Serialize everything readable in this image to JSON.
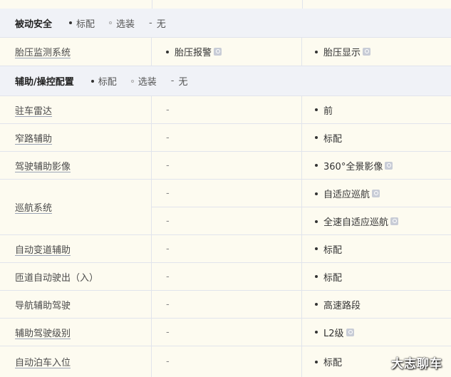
{
  "legend": {
    "standard": "标配",
    "optional": "选装",
    "none": "无"
  },
  "passive_safety": {
    "title": "被动安全",
    "rows": [
      {
        "feature": "胎压监测系统",
        "v1": "胎压报警",
        "v2": "胎压显示"
      }
    ]
  },
  "assist": {
    "title": "辅助/操控配置",
    "rows": [
      {
        "feature": "驻车雷达",
        "v1": "-",
        "v2": "前"
      },
      {
        "feature": "窄路辅助",
        "v1": "-",
        "v2": "标配"
      },
      {
        "feature": "驾驶辅助影像",
        "v1": "-",
        "v2": "360°全景影像"
      },
      {
        "feature": "巡航系统",
        "v1a": "-",
        "v2a": "自适应巡航",
        "v1b": "-",
        "v2b": "全速自适应巡航"
      },
      {
        "feature": "自动变道辅助",
        "v1": "-",
        "v2": "标配"
      },
      {
        "feature": "匝道自动驶出（入）",
        "v1": "-",
        "v2": "标配"
      },
      {
        "feature": "导航辅助驾驶",
        "v1": "-",
        "v2": "高速路段"
      },
      {
        "feature": "辅助驾驶级别",
        "v1": "-",
        "v2": "L2级"
      },
      {
        "feature": "自动泊车入位",
        "v1": "-",
        "v2": "标配"
      }
    ]
  },
  "watermark": "大志聊车"
}
